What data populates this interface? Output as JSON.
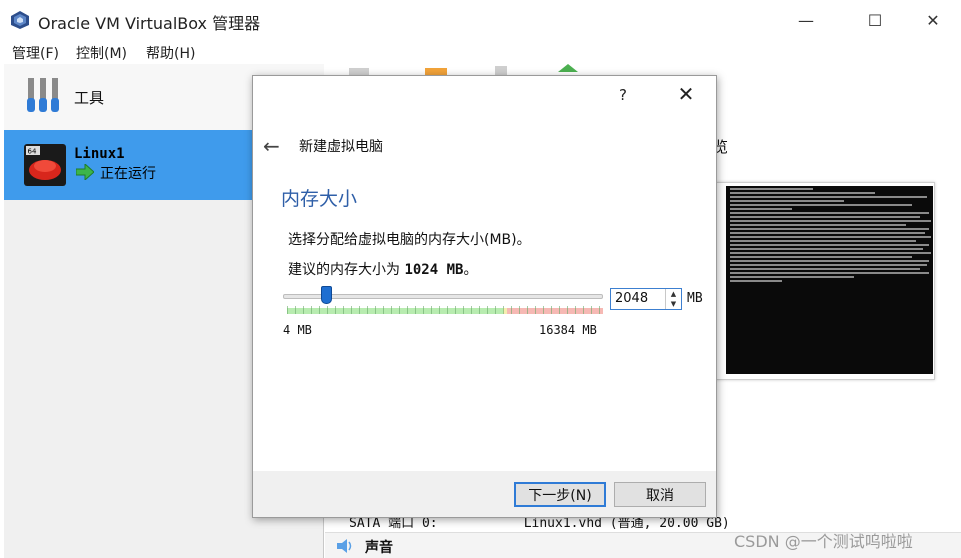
{
  "window": {
    "title": "Oracle VM VirtualBox 管理器",
    "controls": {
      "minimize": "—",
      "maximize": "☐",
      "close": "✕"
    }
  },
  "menu": [
    "管理(F)",
    "控制(M)",
    "帮助(H)"
  ],
  "sidebar": {
    "tools_label": "工具",
    "vm": {
      "name": "Linux1",
      "status": "正在运行",
      "badge": "64"
    }
  },
  "details": {
    "preview_label": "览",
    "storage_line": "SATA 端口 0:           Linux1.vhd (普通, 20.00 GB)",
    "audio_label": "声音"
  },
  "dialog": {
    "help": "?",
    "close": "✕",
    "back_icon": "←",
    "wizard_title": "新建虚拟电脑",
    "section_title": "内存大小",
    "description": "选择分配给虚拟电脑的内存大小(MB)。",
    "recommend_prefix": "建议的内存大小为 ",
    "recommend_value": "1024 MB",
    "recommend_suffix": "。",
    "memory": {
      "value": "2048",
      "unit": "MB",
      "min_label": "4 MB",
      "max_label": "16384 MB",
      "min": 4,
      "max": 16384
    },
    "buttons": {
      "next": "下一步(N)",
      "cancel": "取消"
    }
  },
  "watermark": "CSDN @一个测试呜啦啦",
  "colors": {
    "selection": "#3f9bec",
    "section_title": "#2f5fa8",
    "slider_handle": "#1f6fd1"
  }
}
